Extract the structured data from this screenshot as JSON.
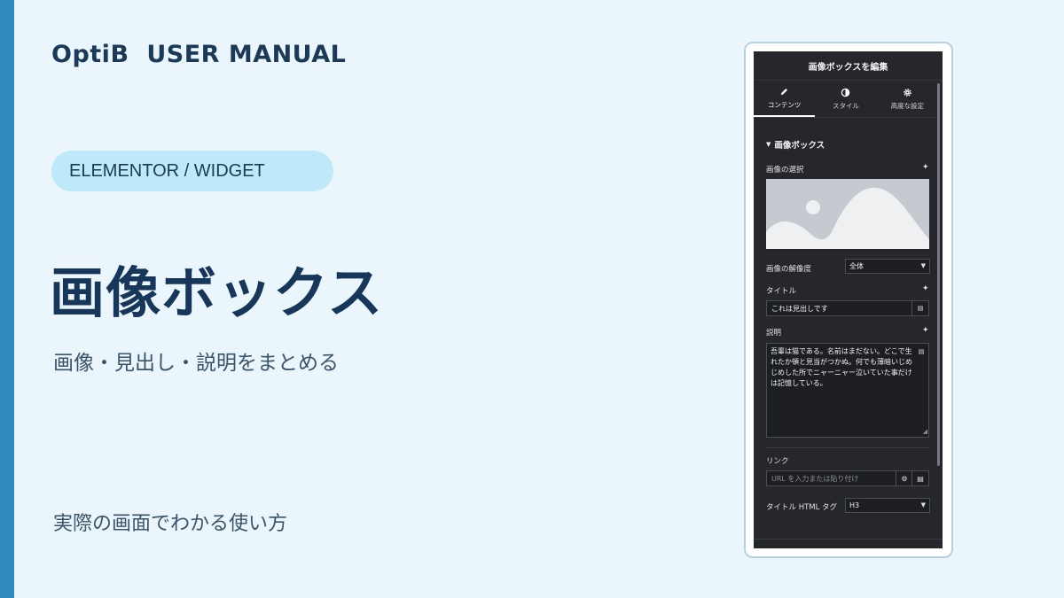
{
  "brand": "OptiB  USER MANUAL",
  "category_pill": "ELEMENTOR / WIDGET",
  "title": "画像ボックス",
  "subtitle": "画像・見出し・説明をまとめる",
  "footnote": "実際の画面でわかる使い方",
  "panel": {
    "header": "画像ボックスを編集",
    "tabs": [
      {
        "label": "コンテンツ",
        "icon": "pencil-icon",
        "active": true
      },
      {
        "label": "スタイル",
        "icon": "contrast-icon",
        "active": false
      },
      {
        "label": "高度な設定",
        "icon": "gear-icon",
        "active": false
      }
    ],
    "section_title": "画像ボックス",
    "image_label": "画像の選択",
    "resolution_label": "画像の解像度",
    "resolution_value": "全体",
    "title_label": "タイトル",
    "title_value": "これは見出しです",
    "description_label": "説明",
    "description_value": "吾輩は猫である。名前はまだない。どこで生れたか頓と見当がつかぬ。何でも薄暗いじめじめした所でニャーニャー泣いていた事だけは記憶している。",
    "link_label": "リンク",
    "link_placeholder": "URL を入力または貼り付け",
    "html_tag_label": "タイトル HTML タグ",
    "html_tag_value": "H3"
  },
  "colors": {
    "accent": "#2f8bbd",
    "background": "#eaf5fc",
    "pill": "#bde9f8",
    "panel_bg": "#25272c"
  }
}
